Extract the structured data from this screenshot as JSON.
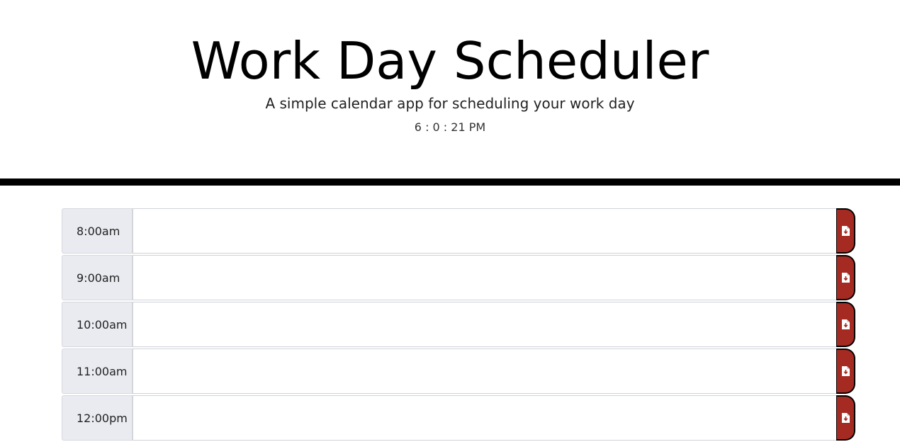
{
  "header": {
    "title": "Work Day Scheduler",
    "lead": "A simple calendar app for scheduling your work day",
    "clock": "6 : 0 : 21 PM"
  },
  "colors": {
    "save_button": "#a52a21",
    "hour_block": "#e9ebf0",
    "divider": "#000000"
  },
  "schedule": {
    "rows": [
      {
        "hour": "8:00am",
        "text": "",
        "icon": "save-file-icon"
      },
      {
        "hour": "9:00am",
        "text": "",
        "icon": "save-file-icon"
      },
      {
        "hour": "10:00am",
        "text": "",
        "icon": "save-file-icon"
      },
      {
        "hour": "11:00am",
        "text": "",
        "icon": "save-file-icon"
      },
      {
        "hour": "12:00pm",
        "text": "",
        "icon": "save-file-icon"
      }
    ]
  }
}
